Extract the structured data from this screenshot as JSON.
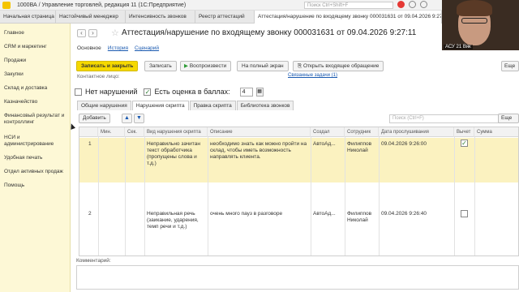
{
  "app": {
    "title": "1000ВА / Управление торговлей, редакция 11  (1С:Предприятие)",
    "search_placeholder": "Поиск Ctrl+Shift+F",
    "notification_count": "1"
  },
  "tabs": [
    {
      "label": "Начальная страница"
    },
    {
      "label": "Настойчивый менеджер"
    },
    {
      "label": "Интенсивность звонков"
    },
    {
      "label": "Реестр аттестаций"
    },
    {
      "label": "Аттестация/нарушение по входящему звонку 000031631 от 09.04.2026 9:27:11"
    }
  ],
  "sidebar": {
    "items": [
      {
        "label": "Главное"
      },
      {
        "label": "CRM и маркетинг"
      },
      {
        "label": "Продажи"
      },
      {
        "label": "Закупки"
      },
      {
        "label": "Склад и доставка"
      },
      {
        "label": "Казначейство"
      },
      {
        "label": "Финансовый результат и контроллинг"
      },
      {
        "label": "НСИ и администрирование"
      },
      {
        "label": "Удобная печать"
      },
      {
        "label": "Отдел активных продаж"
      },
      {
        "label": "Помощь"
      }
    ]
  },
  "video": {
    "label": "АСУ 21 Вяк"
  },
  "document": {
    "title": "Аттестация/нарушение по входящему звонку 000031631 от 09.04.2026 9:27:11",
    "links": {
      "main": "Основное",
      "history": "История",
      "scenario": "Сценарий"
    },
    "toolbar": {
      "save_close": "Записать и закрыть",
      "save": "Записать",
      "play": "Воспроизвести",
      "fullscreen": "На полный экран",
      "open_call": "Открыть входящее обращение",
      "more": "Еще"
    },
    "contact_label": "Контактное лицо:",
    "task_link": "Связанные задачи (1)",
    "no_violations": {
      "label": "Нет нарушений",
      "checked": false
    },
    "has_score": {
      "label": "Есть оценка в баллах:",
      "checked": true
    },
    "score_value": "4",
    "subtabs": [
      "Общие нарушения",
      "Нарушения скрипта",
      "Правка скрипта",
      "Библиотека звонков"
    ],
    "active_subtab": "Нарушения скрипта",
    "table_toolbar": {
      "add": "Добавить",
      "search_placeholder": "Поиск (Ctrl+F)",
      "more": "Еще"
    },
    "table": {
      "columns": [
        "",
        "Мин.",
        "Сек.",
        "Вид нарушения скрипта",
        "Описание",
        "Создал",
        "Сотрудник",
        "Дата прослушивания",
        "Вычет",
        "Сумма"
      ],
      "rows": [
        {
          "n": "1",
          "min": "",
          "sec": "",
          "type": "Неправильно зачитан текст обработчика (пропущены слова и т.д.)",
          "desc": "необходимо знать как можно пройти на склад, чтобы иметь возможность направлять клиента.",
          "created": "АвтоАд...",
          "employee": "Филиппов Николай",
          "date": "09.04.2026 9:26:00",
          "deduct": true,
          "sum": ""
        },
        {
          "n": "2",
          "min": "",
          "sec": "",
          "type": "Неправильная речь (заикание, ударения, темп речи и т.д.)",
          "desc": "очень много пауз в разговоре",
          "created": "АвтоАд...",
          "employee": "Филиппов Николай",
          "date": "09.04.2026 9:26:40",
          "deduct": false,
          "sum": ""
        }
      ]
    },
    "comment_label": "Комментарий:",
    "comment_value": ""
  }
}
